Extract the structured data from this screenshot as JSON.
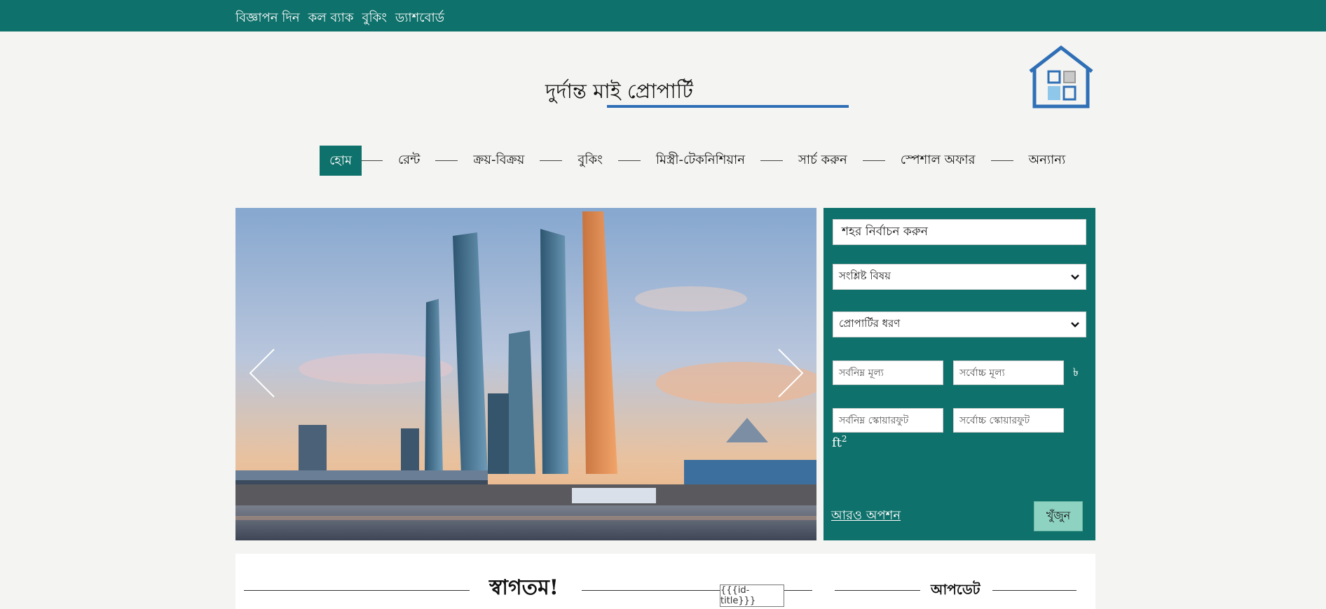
{
  "topbar": {
    "links": [
      "বিজ্ঞাপন দিন",
      "কল ব্যাক",
      "বুকিং",
      "ড্যাশবোর্ড"
    ]
  },
  "header": {
    "title": "দুর্দান্ত মাই প্রোপার্টি",
    "logo_icon": "house-icon"
  },
  "nav": {
    "items": [
      "হোম",
      "রেন্ট",
      "ক্রয়-বিক্রয়",
      "বুকিং",
      "মিস্ত্রী-টেকনিশিয়ান",
      "সার্চ করুন",
      "স্পেশাল অফার",
      "অন্যান্য"
    ],
    "active": "হোম"
  },
  "search": {
    "city_value": "শহর নির্বাচন করুন",
    "subject_select": "সংশ্লিষ্ট বিষয়",
    "property_type_select": "প্রোপার্টির ধরণ",
    "min_price_placeholder": "সর্বনিম্ন মূল্য",
    "max_price_placeholder": "সর্বোচ্চ মূল্য",
    "currency_unit": "৳",
    "min_sqft_placeholder": "সর্বনিম্ন স্কোয়ারফুট",
    "max_sqft_placeholder": "সর্বোচ্চ স্কোয়ারফুট",
    "area_unit": "ft",
    "area_unit_exp": "2",
    "more_options": "আরও অপশন",
    "search_button": "খুঁজুন"
  },
  "bottom": {
    "welcome": "স্বাগতম!",
    "update": "আপডেট",
    "id_title": "{{{id-title}}}"
  },
  "colors": {
    "brand": "#0f716b",
    "accent_blue": "#2f6fb6",
    "search_button": "#8ed3c2"
  }
}
